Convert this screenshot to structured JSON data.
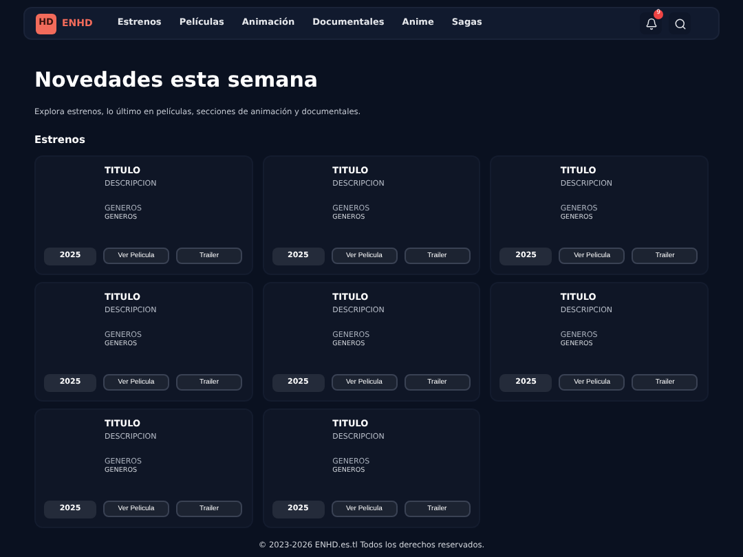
{
  "header": {
    "logo_badge": "HD",
    "logo_text": "ENHD",
    "nav": [
      {
        "label": "Estrenos"
      },
      {
        "label": "Películas"
      },
      {
        "label": "Animación"
      },
      {
        "label": "Documentales"
      },
      {
        "label": "Anime"
      },
      {
        "label": "Sagas"
      }
    ],
    "notification_count": "9"
  },
  "hero": {
    "title": "Novedades esta semana",
    "subtitle": "Explora estrenos, lo último en películas, secciones de animación y documentales."
  },
  "section": {
    "title": "Estrenos",
    "cards": [
      {
        "title": "TITULO",
        "description": "DESCRIPCION",
        "genres": "GENEROS",
        "genres_small": "GENEROS",
        "year": "2025",
        "buttons": [
          "Ver Pelicula",
          "Trailer"
        ]
      },
      {
        "title": "TITULO",
        "description": "DESCRIPCION",
        "genres": "GENEROS",
        "genres_small": "GENEROS",
        "year": "2025",
        "buttons": [
          "Ver Pelicula",
          "Trailer"
        ]
      },
      {
        "title": "TITULO",
        "description": "DESCRIPCION",
        "genres": "GENEROS",
        "genres_small": "GENEROS",
        "year": "2025",
        "buttons": [
          "Ver Pelicula",
          "Trailer"
        ]
      },
      {
        "title": "TITULO",
        "description": "DESCRIPCION",
        "genres": "GENEROS",
        "genres_small": "GENEROS",
        "year": "2025",
        "buttons": [
          "Ver Pelicula",
          "Trailer"
        ]
      },
      {
        "title": "TITULO",
        "description": "DESCRIPCION",
        "genres": "GENEROS",
        "genres_small": "GENEROS",
        "year": "2025",
        "buttons": [
          "Ver Pelicula",
          "Trailer"
        ]
      },
      {
        "title": "TITULO",
        "description": "DESCRIPCION",
        "genres": "GENEROS",
        "genres_small": "GENEROS",
        "year": "2025",
        "buttons": [
          "Ver Pelicula",
          "Trailer"
        ]
      },
      {
        "title": "TITULO",
        "description": "DESCRIPCION",
        "genres": "GENEROS",
        "genres_small": "GENEROS",
        "year": "2025",
        "buttons": [
          "Ver Pelicula",
          "Trailer"
        ]
      },
      {
        "title": "TITULO",
        "description": "DESCRIPCION",
        "genres": "GENEROS",
        "genres_small": "GENEROS",
        "year": "2025",
        "buttons": [
          "Ver Pelicula",
          "Trailer"
        ]
      }
    ]
  },
  "footer": "© 2023-2026 ENHD.es.tl Todos los derechos reservados."
}
